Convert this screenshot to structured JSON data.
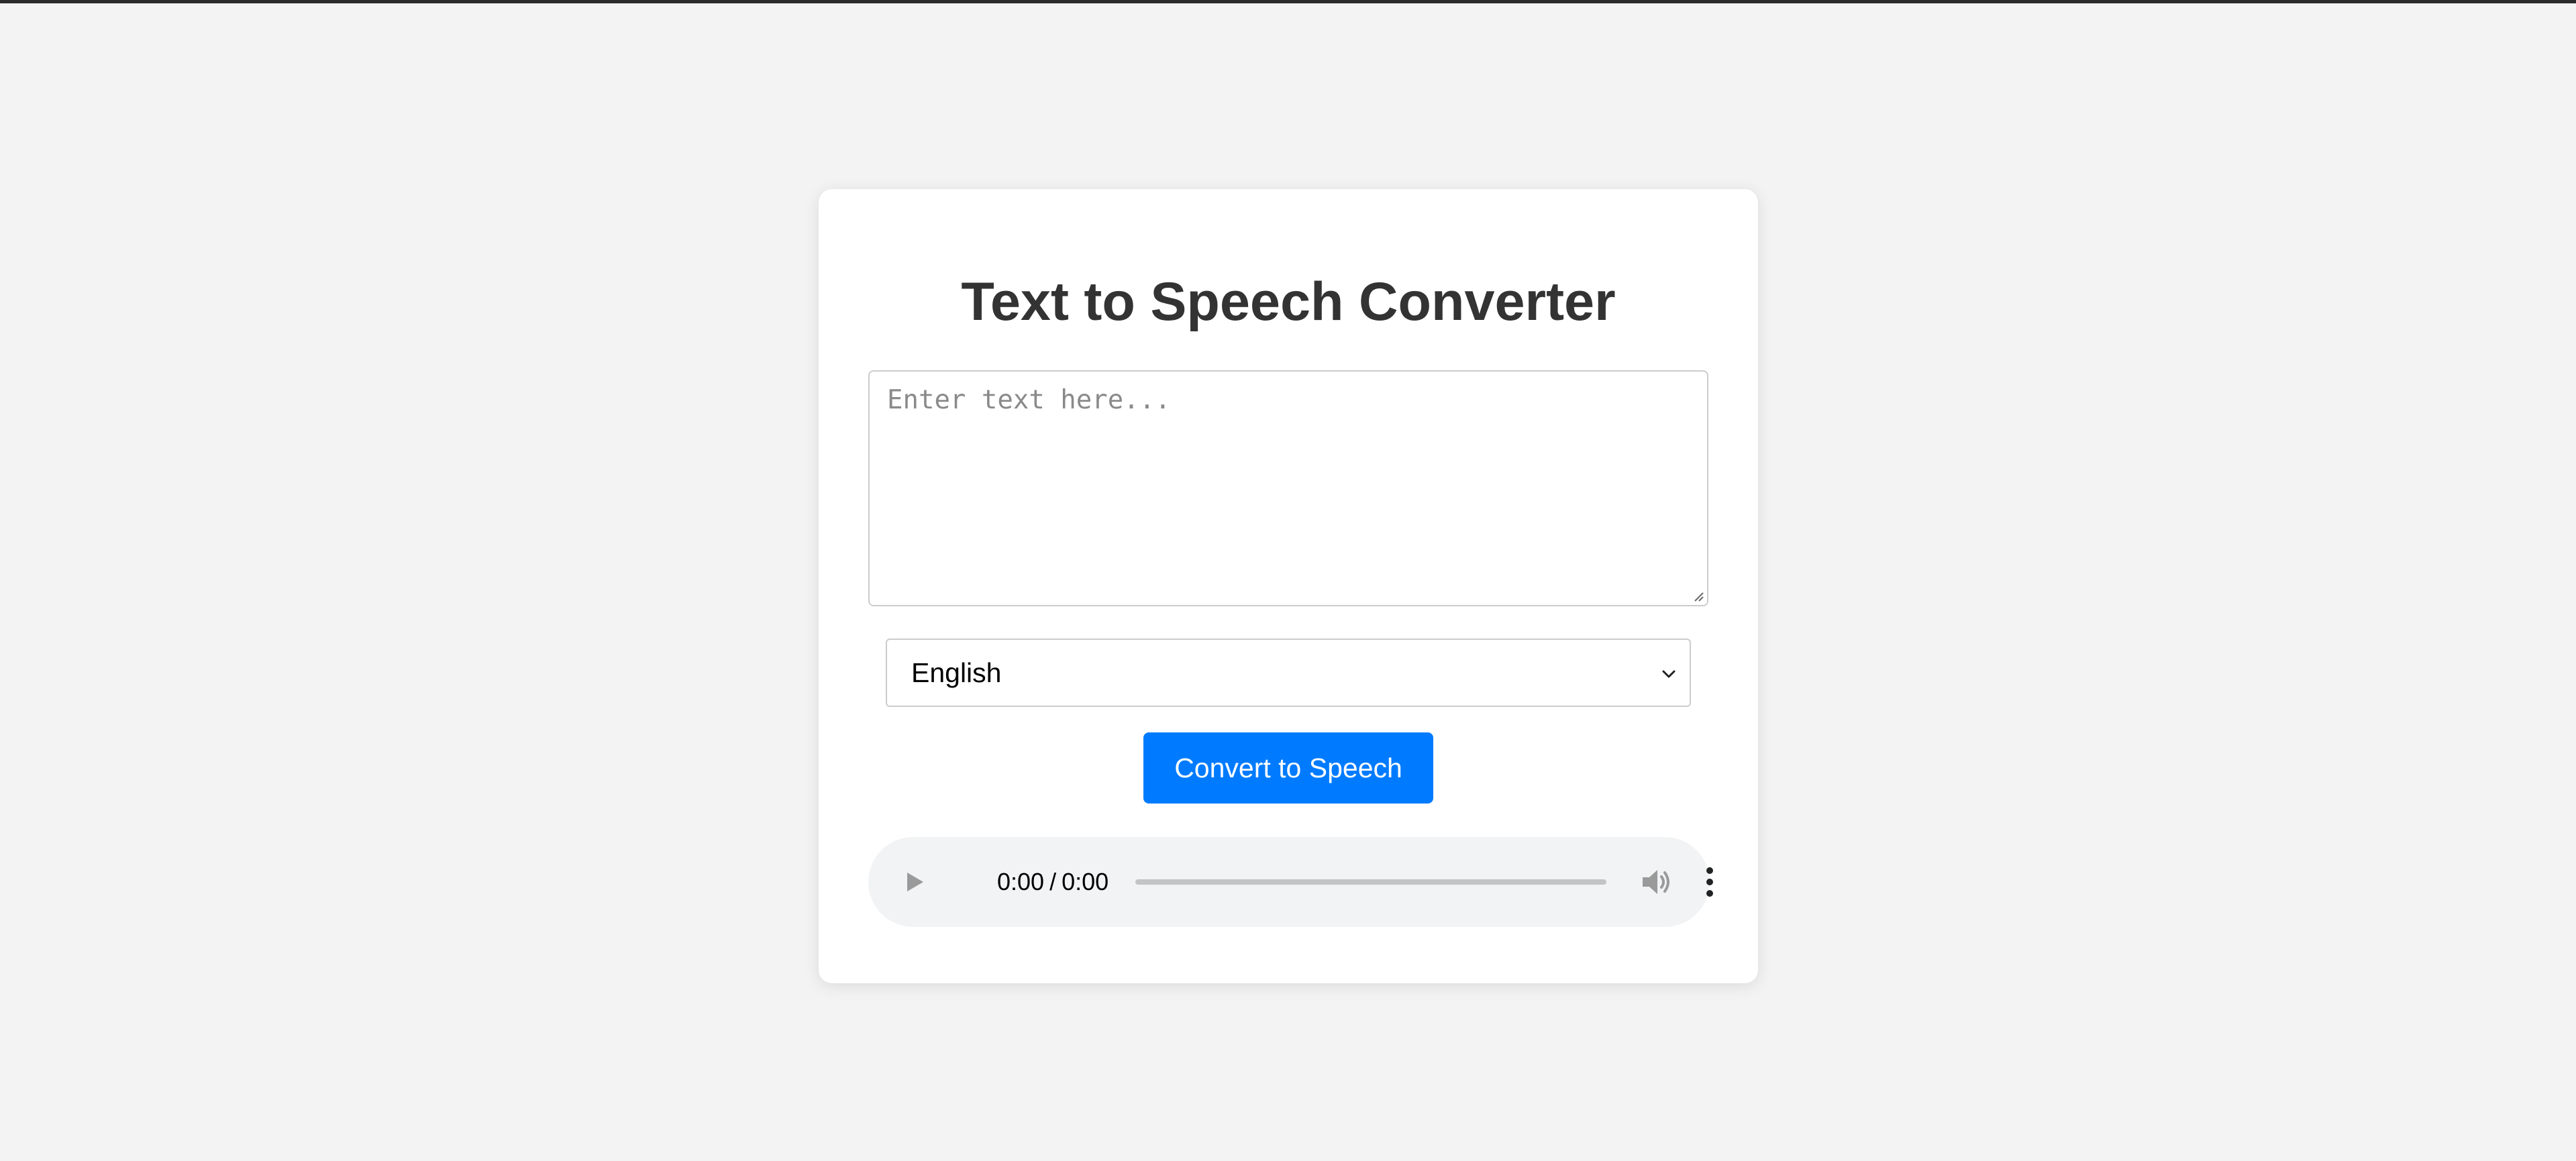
{
  "app": {
    "title": "Text to Speech Converter"
  },
  "text_input": {
    "placeholder": "Enter text here...",
    "value": ""
  },
  "language_select": {
    "selected": "English"
  },
  "convert_button": {
    "label": "Convert to Speech"
  },
  "audio_player": {
    "current_time": "0:00",
    "separator": "/",
    "duration": "0:00",
    "progress": 0,
    "icons": [
      "play-icon",
      "volume-icon",
      "more-options-icon"
    ]
  },
  "colors": {
    "page_background": "#f3f3f3",
    "card_background": "#ffffff",
    "title_text": "#333333",
    "button_background": "#007bff",
    "button_text": "#ffffff",
    "player_background": "#f1f3f4"
  }
}
